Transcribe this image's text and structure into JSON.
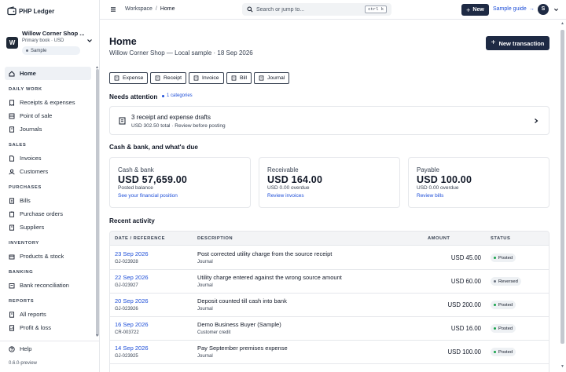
{
  "brand": {
    "name": "PHP Ledger",
    "icon": "wallet-logo-icon"
  },
  "company": {
    "initial": "W",
    "name": "Willow Corner Shop ...",
    "meta": "Primary book · USD",
    "badge": "Sample"
  },
  "nav": {
    "home": "Home",
    "sections": {
      "daily_work": "DAILY WORK",
      "sales": "SALES",
      "purchases": "PURCHASES",
      "inventory": "INVENTORY",
      "banking": "BANKING",
      "reports": "REPORTS"
    },
    "items": {
      "receipts": "Receipts & expenses",
      "pos": "Point of sale",
      "journals": "Journals",
      "invoices": "Invoices",
      "customers": "Customers",
      "bills": "Bills",
      "purchase_orders": "Purchase orders",
      "suppliers": "Suppliers",
      "products": "Products & stock",
      "bank_rec": "Bank reconciliation",
      "all_reports": "All reports",
      "pnl": "Profit & loss"
    },
    "help": "Help",
    "version": "0.6.0-preview"
  },
  "topbar": {
    "breadcrumb": [
      "Workspace",
      "/",
      "Home"
    ],
    "search_placeholder": "Search or jump to...",
    "search_shortcut": "ctrl k",
    "new_label": "New",
    "guide_label": "Sample guide",
    "avatar_initial": "S"
  },
  "page": {
    "title": "Home",
    "subtitle": "Willow Corner Shop — Local sample · 18 Sep 2026",
    "new_transaction": "New transaction",
    "quick_actions": [
      "Expense",
      "Receipt",
      "Invoice",
      "Bill",
      "Journal"
    ]
  },
  "attention": {
    "title": "Needs attention",
    "badge": "1 categories",
    "card_title": "3 receipt and expense drafts",
    "card_sub": "USD 302.50 total · Review before posting"
  },
  "cash_section": {
    "title": "Cash & bank, and what's due",
    "cards": [
      {
        "label": "Cash & bank",
        "value": "USD 57,659.00",
        "note": "Posted balance",
        "link": "See your financial position"
      },
      {
        "label": "Receivable",
        "value": "USD 164.00",
        "note": "USD 0.00 overdue",
        "link": "Review invoices"
      },
      {
        "label": "Payable",
        "value": "USD 100.00",
        "note": "USD 0.00 overdue",
        "link": "Review bills"
      }
    ]
  },
  "activity": {
    "title": "Recent activity",
    "columns": [
      "DATE / REFERENCE",
      "DESCRIPTION",
      "AMOUNT",
      "STATUS"
    ],
    "rows": [
      {
        "date": "23 Sep 2026",
        "ref": "GJ-023928",
        "desc": "Post corrected utility charge from the source receipt",
        "type": "Journal",
        "amount": "USD 45.00",
        "status": "Posted",
        "status_color": "#16a34a"
      },
      {
        "date": "22 Sep 2026",
        "ref": "GJ-023927",
        "desc": "Utility charge entered against the wrong source amount",
        "type": "Journal",
        "amount": "USD 60.00",
        "status": "Reversed",
        "status_color": "#6b7280"
      },
      {
        "date": "20 Sep 2026",
        "ref": "GJ-023926",
        "desc": "Deposit counted till cash into bank",
        "type": "Journal",
        "amount": "USD 200.00",
        "status": "Posted",
        "status_color": "#16a34a"
      },
      {
        "date": "16 Sep 2026",
        "ref": "CR-003722",
        "desc": "Demo Business Buyer (Sample)",
        "type": "Customer credit",
        "amount": "USD 16.00",
        "status": "Posted",
        "status_color": "#16a34a"
      },
      {
        "date": "14 Sep 2026",
        "ref": "GJ-023925",
        "desc": "Pay September premises expense",
        "type": "Journal",
        "amount": "USD 100.00",
        "status": "Posted",
        "status_color": "#16a34a"
      }
    ]
  }
}
